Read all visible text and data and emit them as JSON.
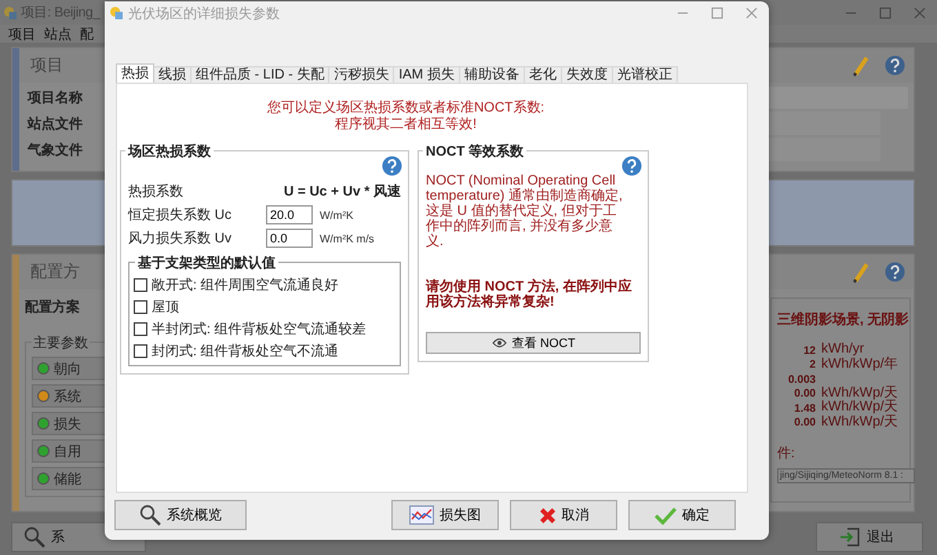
{
  "main_window": {
    "title": "项目: Beijing_",
    "menu": [
      "项目",
      "站点",
      "配"
    ],
    "project_panel": {
      "title": "项目",
      "rows": [
        "项目名称",
        "站点文件",
        "气象文件"
      ]
    },
    "config_panel": {
      "title": "配置方",
      "subtitle": "配置方案",
      "group_title": "主要参数",
      "params": [
        {
          "label": "朝向",
          "color": "#2fa12f"
        },
        {
          "label": "系统",
          "color": "#d08a1a"
        },
        {
          "label": "损失",
          "color": "#2fa12f"
        },
        {
          "label": "自用",
          "color": "#2fa12f"
        },
        {
          "label": "储能",
          "color": "#2fa12f"
        }
      ],
      "summary_title": "三维阴影场景, 无阴影",
      "summary_rows": [
        {
          "value": "12",
          "unit": "kWh/yr"
        },
        {
          "value": "2",
          "unit": "kWh/kWp/年"
        },
        {
          "value": "0.003"
        },
        {
          "value": "0.00",
          "unit": "kWh/kWp/天"
        },
        {
          "value": "1.48",
          "unit": "kWh/kWp/天"
        },
        {
          "value": "0.00",
          "unit": "kWh/kWp/天"
        }
      ],
      "file_label": "件:",
      "file_value": "jing/Sijiqing/MeteoNorm 8.1 :"
    },
    "overview_button": "系",
    "exit_button": "退出"
  },
  "dialog": {
    "title": "光伏场区的详细损失参数",
    "tabs": [
      {
        "label": "热损",
        "selected": true
      },
      {
        "label": "线损",
        "selected": false
      },
      {
        "label": "组件品质 - LID - 失配",
        "selected": false
      },
      {
        "label": "污秽损失",
        "selected": false
      },
      {
        "label": "IAM 损失",
        "selected": false
      },
      {
        "label": "辅助设备",
        "selected": false
      },
      {
        "label": "老化",
        "selected": false
      },
      {
        "label": "失效度",
        "selected": false
      },
      {
        "label": "光谱校正",
        "selected": false
      }
    ],
    "notice": [
      "您可以定义场区热损系数或者标准NOCT系数:",
      "程序视其二者相互等效!"
    ],
    "thermal_group": {
      "title": "场区热损系数",
      "formula_label": "热损系数",
      "formula": "U = Uc + Uv * 风速",
      "fields": [
        {
          "label": "恒定损失系数 Uc",
          "value": "20.0",
          "unit": "W/m²K"
        },
        {
          "label": "风力损失系数 Uv",
          "value": "0.0",
          "unit": "W/m²K m/s"
        }
      ],
      "defaults_title": "基于支架类型的默认值",
      "options": [
        {
          "label": "敞开式: 组件周围空气流通良好",
          "checked": false
        },
        {
          "label": "屋顶",
          "checked": false
        },
        {
          "label": "半封闭式: 组件背板处空气流通较差",
          "checked": false
        },
        {
          "label": "封闭式: 组件背板处空气不流通",
          "checked": false
        }
      ]
    },
    "noct_group": {
      "title": "NOCT 等效系数",
      "description": "NOCT (Nominal Operating Cell temperature) 通常由制造商确定, 这是 U 值的替代定义, 但对于工作中的阵列而言, 并没有多少意义.",
      "warning": "请勿使用 NOCT 方法, 在阵列中应用该方法将异常复杂!",
      "button": "查看 NOCT"
    },
    "buttons": [
      {
        "label": "系统概览",
        "kind": "overview"
      },
      {
        "label": "损失图",
        "kind": "chart"
      },
      {
        "label": "取消",
        "kind": "cancel"
      },
      {
        "label": "确定",
        "kind": "ok"
      }
    ]
  }
}
